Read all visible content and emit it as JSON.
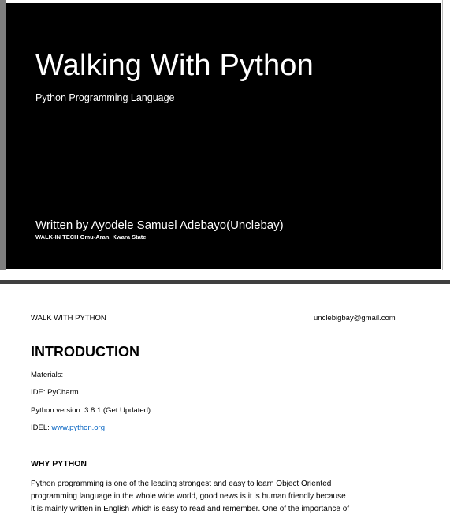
{
  "cover": {
    "title": "Walking With Python",
    "subtitle": "Python Programming Language",
    "author": "Written by Ayodele Samuel Adebayo(Unclebay)",
    "organization": "WALK-IN TECH  Omu-Aran, Kwara State"
  },
  "page_two": {
    "header": {
      "left": "WALK WITH PYTHON",
      "right": "unclebigbay@gmail.com"
    },
    "heading": "INTRODUCTION",
    "materials_label": "Materials:",
    "ide": "IDE: PyCharm",
    "python_version": "Python version: 3.8.1 (Get Updated)",
    "idel_label": "IDEL: ",
    "idel_link": "www.python.org",
    "why_heading": "WHY PYTHON",
    "paragraph_lines": [
      "Python programming is one of the leading strongest and easy to learn Object Oriented",
      "programming language in the whole wide world, good news is it is human friendly because",
      "it is mainly written in English which is easy to read and remember. One of the importance of"
    ]
  },
  "colors": {
    "cover_background": "#000000",
    "cover_side_bar": "#7f7f7f",
    "link": "#0563c1",
    "separator": "#3f3f3f"
  }
}
